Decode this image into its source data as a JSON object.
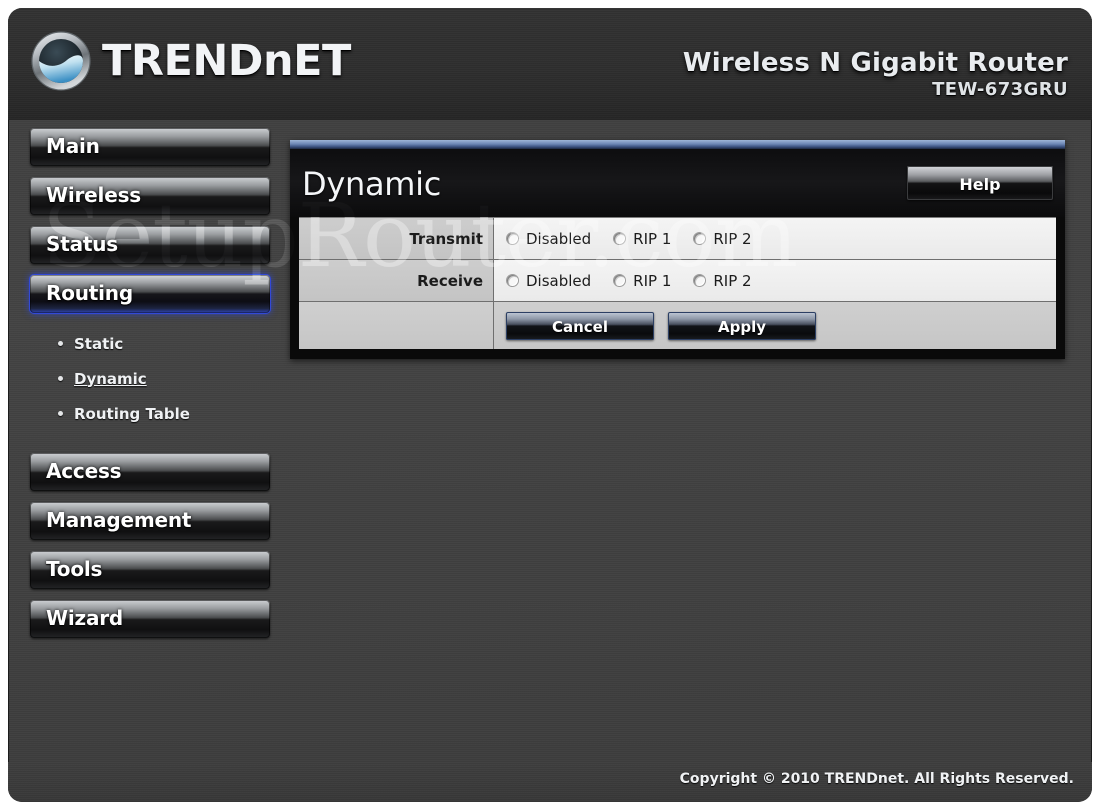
{
  "header": {
    "brand": "TRENDnET",
    "brand_logo_icon": "trendnet-swirl-logo-icon",
    "product_name": "Wireless N Gigabit Router",
    "product_model": "TEW-673GRU"
  },
  "sidebar": {
    "items": [
      {
        "label": "Main",
        "active": false
      },
      {
        "label": "Wireless",
        "active": false
      },
      {
        "label": "Status",
        "active": false
      },
      {
        "label": "Routing",
        "active": true
      },
      {
        "label": "Access",
        "active": false
      },
      {
        "label": "Management",
        "active": false
      },
      {
        "label": "Tools",
        "active": false
      },
      {
        "label": "Wizard",
        "active": false
      }
    ],
    "subitems": [
      {
        "label": "Static",
        "current": false
      },
      {
        "label": "Dynamic",
        "current": true
      },
      {
        "label": "Routing Table",
        "current": false
      }
    ]
  },
  "panel": {
    "title": "Dynamic",
    "help_label": "Help",
    "rows": [
      {
        "label": "Transmit",
        "options": [
          {
            "label": "Disabled",
            "selected": false
          },
          {
            "label": "RIP 1",
            "selected": false
          },
          {
            "label": "RIP 2",
            "selected": false
          }
        ]
      },
      {
        "label": "Receive",
        "options": [
          {
            "label": "Disabled",
            "selected": false
          },
          {
            "label": "RIP 1",
            "selected": false
          },
          {
            "label": "RIP 2",
            "selected": false
          }
        ]
      }
    ],
    "cancel_label": "Cancel",
    "apply_label": "Apply"
  },
  "footer": {
    "copyright": "Copyright © 2010 TRENDnet. All Rights Reserved."
  },
  "watermark": {
    "text": "SetupRouter.com"
  },
  "colors": {
    "accent_blue": "#2f46b8",
    "panel_bg": "#0a0a0a",
    "page_bg": "#3f3f3f",
    "row_label_bg": "#c8c8c8",
    "row_value_bg": "#f0f0f0"
  }
}
